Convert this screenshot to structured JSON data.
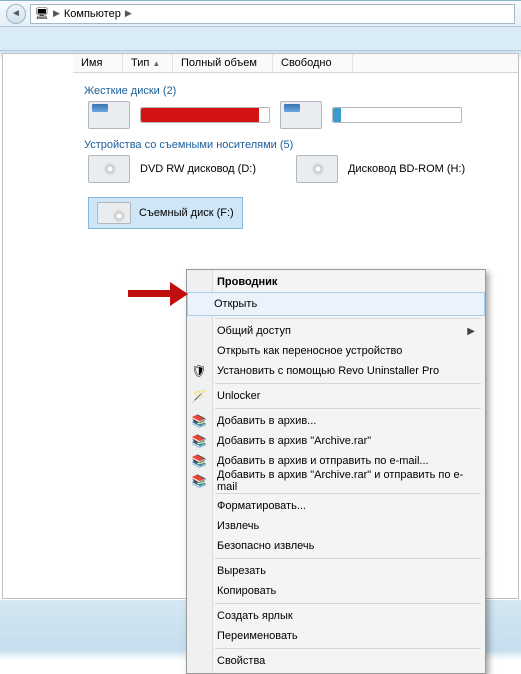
{
  "breadcrumb": {
    "root_icon": "computer-icon",
    "label": "Компьютер"
  },
  "columns": {
    "name": "Имя",
    "type": "Тип",
    "volume": "Полный объем",
    "free": "Свободно"
  },
  "groups": {
    "hdd": {
      "title": "Жесткие диски",
      "count": "(2)"
    },
    "removable": {
      "title": "Устройства со съемными носителями",
      "count": "(5)"
    }
  },
  "drives": {
    "dvd": "DVD RW дисковод (D:)",
    "bd": "Дисковод BD-ROM (H:)",
    "usb_selected": "Съемный диск (F:)"
  },
  "context_menu": {
    "explorer": "Проводник",
    "open": "Открыть",
    "share": "Общий доступ",
    "open_portable": "Открыть как переносное устройство",
    "revo": "Установить с помощью Revo Uninstaller Pro",
    "unlocker": "Unlocker",
    "add_archive": "Добавить в архив...",
    "add_archive_rar": "Добавить в архив \"Archive.rar\"",
    "add_archive_email": "Добавить в архив и отправить по e-mail...",
    "add_archive_rar_email": "Добавить в архив \"Archive.rar\" и отправить по e-mail",
    "format": "Форматировать...",
    "eject": "Извлечь",
    "safe_eject": "Безопасно извлечь",
    "cut": "Вырезать",
    "copy": "Копировать",
    "shortcut": "Создать ярлык",
    "rename": "Переименовать",
    "properties": "Свойства"
  }
}
